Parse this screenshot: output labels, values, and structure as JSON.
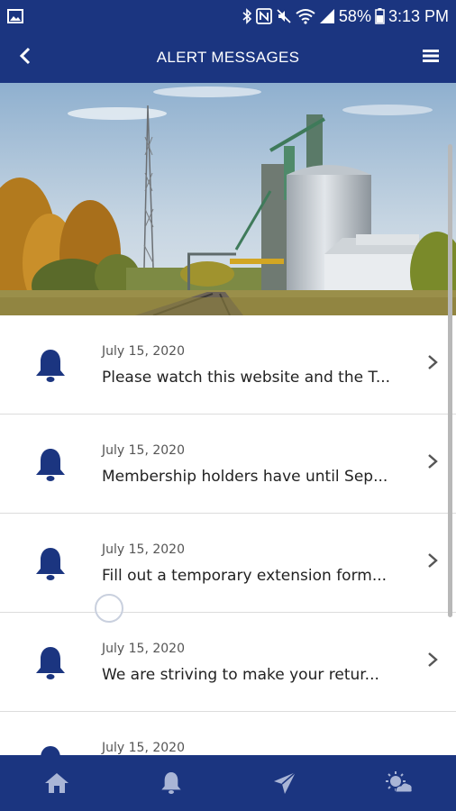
{
  "status_bar": {
    "battery": "58%",
    "time": "3:13 PM",
    "icons": [
      "image-icon",
      "bluetooth-icon",
      "nfc-icon",
      "mute-icon",
      "wifi-icon",
      "signal-icon",
      "battery-icon"
    ]
  },
  "app_bar": {
    "title": "ALERT MESSAGES",
    "back_icon": "chevron-left-icon",
    "menu_icon": "hamburger-menu-icon"
  },
  "hero": {
    "image": "grain-elevator-photo"
  },
  "alerts": [
    {
      "date": "July 15, 2020",
      "message": "Please watch this website and the T..."
    },
    {
      "date": "July 15, 2020",
      "message": "Membership holders have until Sep..."
    },
    {
      "date": "July 15, 2020",
      "message": "Fill out a temporary extension form..."
    },
    {
      "date": "July 15, 2020",
      "message": "We are striving to make your retur..."
    },
    {
      "date": "July 15, 2020",
      "message": ""
    }
  ],
  "bottom_nav": {
    "items": [
      "home-icon",
      "bell-icon",
      "send-icon",
      "weather-icon"
    ]
  },
  "colors": {
    "primary": "#1b3580",
    "icon": "#1b3580",
    "nav_icon": "#a9b5d6",
    "divider": "#dcdcdc"
  }
}
